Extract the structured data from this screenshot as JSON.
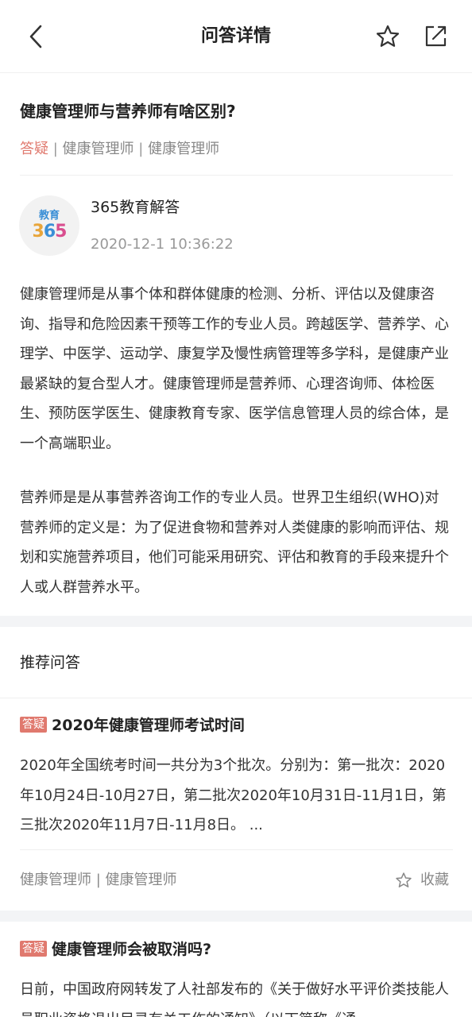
{
  "header": {
    "title": "问答详情",
    "back_icon": "chevron-left-icon",
    "favorite_icon": "star-outline-icon",
    "share_icon": "share-external-icon"
  },
  "question": {
    "title": "健康管理师与营养师有啥区别?",
    "tag_type": "答疑",
    "separator": "|",
    "category1": "健康管理师",
    "category2": "健康管理师"
  },
  "author": {
    "avatar_line1": "教育",
    "avatar_digit1": "3",
    "avatar_digit2": "6",
    "avatar_digit3": "5",
    "name": "365教育解答",
    "time": "2020-12-1 10:36:22"
  },
  "answer": {
    "paragraph1": "健康管理师是从事个体和群体健康的检测、分析、评估以及健康咨询、指导和危险因素干预等工作的专业人员。跨越医学、营养学、心理学、中医学、运动学、康复学及慢性病管理等多学科，是健康产业最紧缺的复合型人才。健康管理师是营养师、心理咨询师、体检医生、预防医学医生、健康教育专家、医学信息管理人员的综合体，是一个高端职业。",
    "paragraph2": "营养师是是从事营养咨询工作的专业人员。世界卫生组织(WHO)对营养师的定义是：为了促进食物和营养对人类健康的影响而评估、规划和实施营养项目，他们可能采用研究、评估和教育的手段来提升个人或人群营养水平。"
  },
  "recommend": {
    "title": "推荐问答",
    "items": [
      {
        "badge": "答疑",
        "title": "2020年健康管理师考试时间",
        "summary": "2020年全国统考时间一共分为3个批次。分别为：第一批次：2020年10月24日-10月27日，第二批次2020年10月31日-11月1日，第三批次2020年11月7日-11月8日。 ...",
        "tags": "健康管理师 | 健康管理师",
        "collect_label": "收藏"
      },
      {
        "badge": "答疑",
        "title": "健康管理师会被取消吗?",
        "summary": "日前，中国政府网转发了人社部发布的《关于做好水平评价类技能人员职业资格退出目录有关工作的通知》（以下简称《通"
      }
    ]
  },
  "colors": {
    "accent": "#e0796e",
    "text_primary": "#222222",
    "text_secondary": "#888888",
    "band": "#f3f4f6"
  }
}
